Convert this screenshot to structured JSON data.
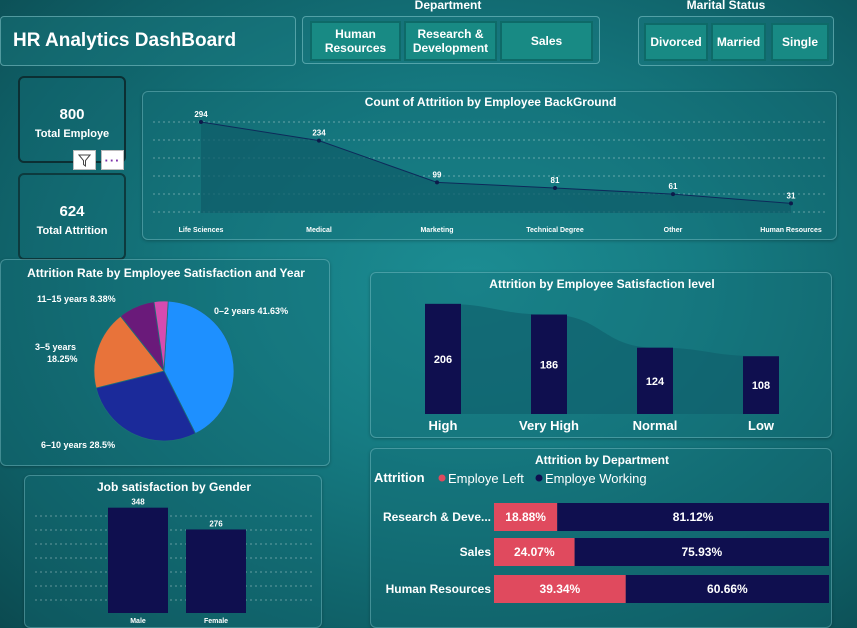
{
  "app_title": "HR Analytics DashBoard",
  "slicers": {
    "department": {
      "label": "Department",
      "options": [
        "Human Resources",
        "Research & Development",
        "Sales"
      ]
    },
    "marital": {
      "label": "Marital Status",
      "options": [
        "Divorced",
        "Married",
        "Single"
      ]
    }
  },
  "kpis": [
    {
      "value": "800",
      "label": "Total Employe"
    },
    {
      "value": "624",
      "label": "Total Attrition"
    }
  ],
  "colors": {
    "navy": "#0f0f4f",
    "left": "#e04a5e",
    "area": "#0f5e6a",
    "pie": [
      "#1e90ff",
      "#1b2a9a",
      "#e8733a",
      "#6a1a7a",
      "#d64bb0"
    ]
  },
  "icons": [
    "filter-icon",
    "more-options-icon"
  ],
  "chart_data": [
    {
      "id": "background",
      "type": "area",
      "title": "Count of Attrition by Employee BackGround",
      "categories": [
        "Life Sciences",
        "Medical",
        "Marketing",
        "Technical Degree",
        "Other",
        "Human Resources"
      ],
      "values": [
        294,
        234,
        99,
        81,
        61,
        31
      ],
      "ylim": [
        0,
        320
      ]
    },
    {
      "id": "satisfaction_pie",
      "type": "pie",
      "title": "Attrition Rate by Employee Satisfaction and Year",
      "slices": [
        {
          "label": "0–2 years",
          "pct_label": "41.63%",
          "value": 41.63
        },
        {
          "label": "6–10 years",
          "pct_label": "28.5%",
          "value": 28.5
        },
        {
          "label": "3–5 years",
          "pct_label": "18.25%",
          "value": 18.25
        },
        {
          "label": "11–15 years",
          "pct_label": "8.38%",
          "value": 8.38
        },
        {
          "label": "",
          "pct_label": "",
          "value": 3.24
        }
      ]
    },
    {
      "id": "satisfaction_level",
      "type": "bar",
      "title": "Attrition by Employee Satisfaction level",
      "categories": [
        "High",
        "Very High",
        "Normal",
        "Low"
      ],
      "values": [
        206,
        186,
        124,
        108
      ],
      "ylim": [
        0,
        230
      ]
    },
    {
      "id": "gender",
      "type": "bar",
      "title": "Job satisfaction by Gender",
      "categories": [
        "Male",
        "Female"
      ],
      "values": [
        348,
        276
      ],
      "ylim": [
        0,
        380
      ]
    },
    {
      "id": "department",
      "type": "bar",
      "title": "Attrition by Department",
      "legend_title": "Attrition",
      "series_names": [
        "Employe Left",
        "Employe Working"
      ],
      "categories": [
        "Research & Deve...",
        "Sales",
        "Human Resources"
      ],
      "left": [
        18.88,
        24.07,
        39.34
      ],
      "working": [
        81.12,
        75.93,
        60.66
      ],
      "left_labels": [
        "18.88%",
        "24.07%",
        "39.34%"
      ],
      "working_labels": [
        "81.12%",
        "75.93%",
        "60.66%"
      ]
    }
  ]
}
